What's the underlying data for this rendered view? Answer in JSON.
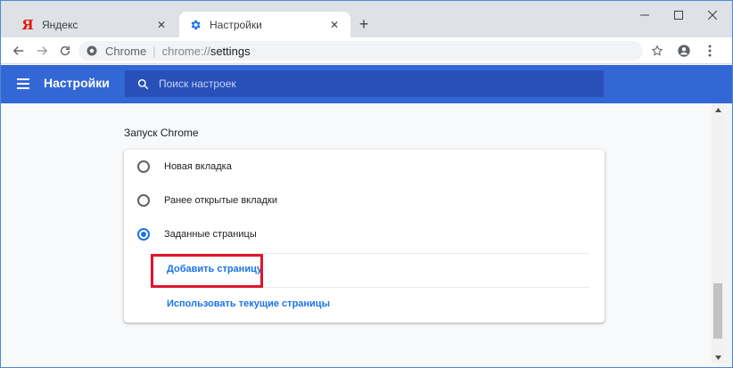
{
  "tabs": [
    {
      "title": "Яндекс",
      "favicon": "yandex-logo",
      "favicon_text": "Я",
      "active": false
    },
    {
      "title": "Настройки",
      "favicon": "gear-icon",
      "active": true
    }
  ],
  "toolbar": {
    "site_chip": "Chrome",
    "url_scheme": "chrome://",
    "url_rest": "settings"
  },
  "header": {
    "title": "Настройки",
    "search_placeholder": "Поиск настроек"
  },
  "section": {
    "title": "Запуск Chrome",
    "options": [
      {
        "label": "Новая вкладка",
        "checked": false
      },
      {
        "label": "Ранее открытые вкладки",
        "checked": false
      },
      {
        "label": "Заданные страницы",
        "checked": true
      }
    ],
    "add_page_link": "Добавить страницу",
    "use_current_link": "Использовать текущие страницы"
  },
  "colors": {
    "accent": "#3367d6",
    "link": "#1a73e8",
    "highlight": "#e0152b"
  }
}
